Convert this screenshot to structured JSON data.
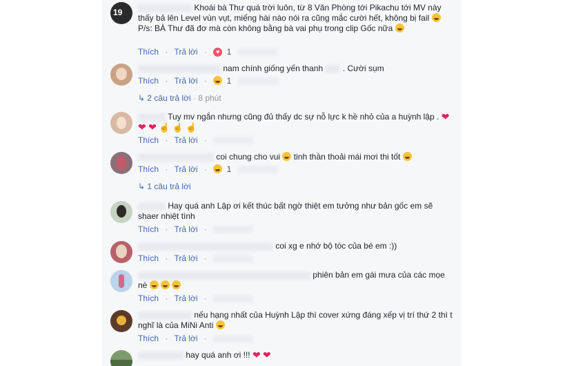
{
  "actions": {
    "like": "Thích",
    "reply": "Trả lời",
    "dot": "·"
  },
  "comments": [
    {
      "text": "Khoái bà Thư quá trời luôn, từ 8 Văn Phòng tới Pikachu tới MV này thấy bả lên Level vùn vụt, miếng hài nào nói ra cũng mắc cười hết, không bị fail",
      "text_b": " P/s: BÀ Thư đã đơ mà còn không bằng bà vai phụ trong clip Gốc nữa",
      "reaction_count": "1"
    },
    {
      "text": "nam chính giống yến thanh",
      "text_b": ". Cười sụm",
      "reaction_count": "1",
      "replies": "2 câu trả lời",
      "replies_time": "8 phút"
    },
    {
      "text": "Tuy mv ngắn nhưng cũng đủ thấy dc sự nỗ lực k hề nhỏ của a huỳnh lập ."
    },
    {
      "text": "coi chung cho vui",
      "text_b": " tinh thần thoải mái mơi thi tốt",
      "reaction_count": "1",
      "replies": "1 câu trả lời"
    },
    {
      "text": "Hay quá anh Lập ơi kết thúc bất ngờ thiệt em tưởng như bản gốc em sẽ shaer nhiệt tình"
    },
    {
      "text": "coi xg e nhớ bộ tóc của bé em :))"
    },
    {
      "text": "phiên bản em gái mưa của các mọe nè"
    },
    {
      "text": "nếu hạng nhất của Huỳnh Lập thì cover xứng đáng xếp vị trí thứ 2 thì t nghĩ là của MiNi Anti"
    },
    {
      "text": "hay quá anh ơi !!!"
    }
  ]
}
